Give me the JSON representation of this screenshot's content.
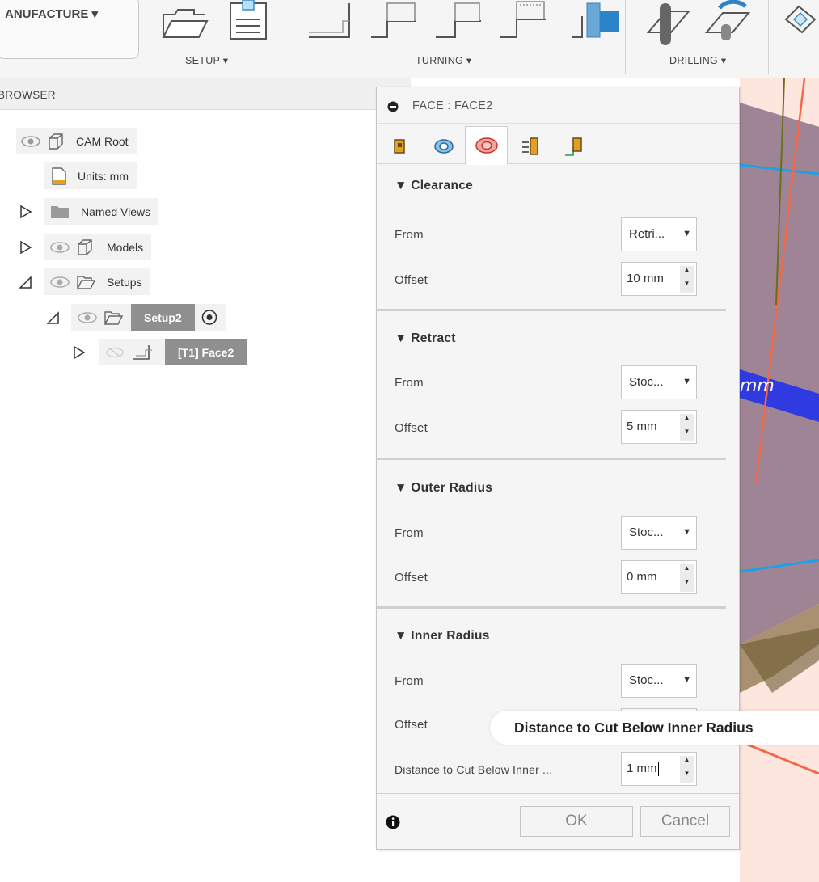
{
  "toolbar": {
    "workspace": "ANUFACTURE ▾",
    "groups": [
      {
        "label": "SETUP ▾"
      },
      {
        "label": "TURNING ▾"
      },
      {
        "label": "DRILLING ▾"
      }
    ]
  },
  "browser": {
    "title": "BROWSER",
    "nodes": {
      "root": "CAM Root",
      "units": "Units: mm",
      "named_views": "Named Views",
      "models": "Models",
      "setups": "Setups",
      "setup2": "Setup2",
      "face2": "[T1] Face2"
    }
  },
  "dialog": {
    "title": "FACE : FACE2",
    "sections": {
      "clearance": {
        "title": "▼ Clearance",
        "from_label": "From",
        "from_value": "Retri...",
        "offset_label": "Offset",
        "offset_value": "10 mm"
      },
      "retract": {
        "title": "▼ Retract",
        "from_label": "From",
        "from_value": "Stoc...",
        "offset_label": "Offset",
        "offset_value": "5 mm"
      },
      "outer": {
        "title": "▼ Outer Radius",
        "from_label": "From",
        "from_value": "Stoc...",
        "offset_label": "Offset",
        "offset_value": "0 mm"
      },
      "inner": {
        "title": "▼ Inner Radius",
        "from_label": "From",
        "from_value": "Stoc...",
        "offset_label": "Offset",
        "distance_label": "Distance to Cut Below Inner ...",
        "distance_value": "1 mm"
      }
    },
    "tooltip": "Distance to Cut Below Inner Radius",
    "ok": "OK",
    "cancel": "Cancel"
  },
  "viewport": {
    "dimension_text": "mm"
  },
  "colors": {
    "accent_blue": "#1ea0e6",
    "orange_line": "#f06a4a",
    "model_purple": "#9e8494"
  }
}
